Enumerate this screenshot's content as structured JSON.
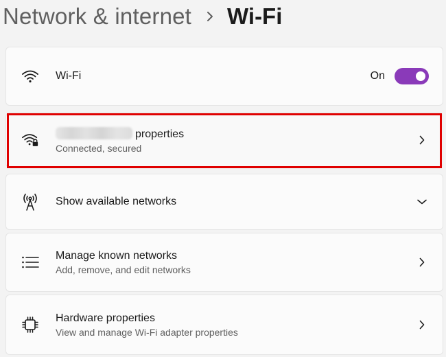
{
  "breadcrumb": {
    "parent": "Network & internet",
    "current": "Wi-Fi"
  },
  "wifi_toggle": {
    "label": "Wi-Fi",
    "state_label": "On",
    "is_on": true,
    "accent_color": "#8a3ab9"
  },
  "network_properties": {
    "title_suffix": "properties",
    "status": "Connected, secured",
    "ssid_obscured": true,
    "highlight_color": "#e00000"
  },
  "available_networks": {
    "title": "Show available networks"
  },
  "known_networks": {
    "title": "Manage known networks",
    "subtitle": "Add, remove, and edit networks"
  },
  "hardware": {
    "title": "Hardware properties",
    "subtitle": "View and manage Wi-Fi adapter properties"
  },
  "icons": {
    "wifi": "wifi-icon",
    "wifi_secured": "wifi-lock-icon",
    "antenna": "antenna-icon",
    "list": "list-icon",
    "chip": "chip-icon",
    "chevron_right": "chevron-right-icon",
    "chevron_down": "chevron-down-icon"
  }
}
